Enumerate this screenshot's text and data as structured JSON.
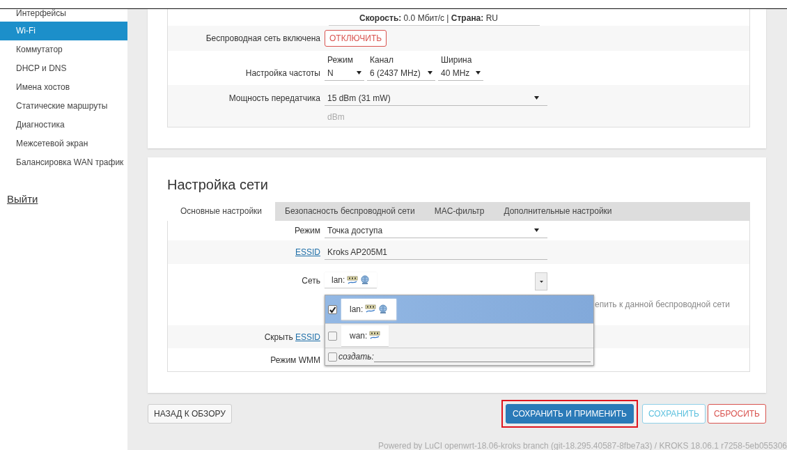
{
  "sidebar": {
    "items": [
      {
        "label": "Интерфейсы",
        "selected": false
      },
      {
        "label": "Wi-Fi",
        "selected": true
      },
      {
        "label": "Коммутатор",
        "selected": false
      },
      {
        "label": "DHCP и DNS",
        "selected": false
      },
      {
        "label": "Имена хостов",
        "selected": false
      },
      {
        "label": "Статические маршруты",
        "selected": false
      },
      {
        "label": "Диагностика",
        "selected": false
      },
      {
        "label": "Межсетевой экран",
        "selected": false
      },
      {
        "label": "Балансировка WAN трафик",
        "selected": false
      }
    ],
    "logout": "Выйти"
  },
  "device": {
    "status_line": "**Скорость:** 0.0 Мбит/с | **Страна:** RU",
    "enable": {
      "label": "Беспроводная сеть включена",
      "button": "ОТКЛЮЧИТЬ"
    },
    "frequency": {
      "label": "Настройка частоты",
      "selects": [
        {
          "caption": "Режим",
          "value": "N"
        },
        {
          "caption": "Канал",
          "value": "6 (2437 MHz)"
        },
        {
          "caption": "Ширина",
          "value": "40 MHz"
        }
      ]
    },
    "power": {
      "label": "Мощность передатчика",
      "value": "15 dBm (31 mW)",
      "hint": "dBm"
    }
  },
  "network": {
    "title": "Настройка сети",
    "tabs": [
      {
        "label": "Основные настройки",
        "selected": true
      },
      {
        "label": "Безопасность беспроводной сети",
        "selected": false
      },
      {
        "label": "MAC-фильтр",
        "selected": false
      },
      {
        "label": "Дополнительные настройки",
        "selected": false
      }
    ],
    "fields": [
      {
        "kind": "select",
        "label": "Режим",
        "value": "Точка доступа"
      },
      {
        "kind": "text",
        "label_link": "ESSID",
        "value": "Kroks AP205M1"
      },
      {
        "kind": "network",
        "label": "Сеть",
        "value": "lan:",
        "wireless": true,
        "hint": "епить к данной беспроводной сети",
        "dropdown": {
          "options": [
            {
              "label": "lan:",
              "wireless": true,
              "checked": true,
              "selected": true
            },
            {
              "label": "wan:",
              "wireless": false,
              "checked": false,
              "selected": false
            }
          ],
          "create": {
            "label": "создать:",
            "checked": false
          }
        }
      },
      {
        "kind": "empty",
        "label": "Скрыть ",
        "label_link": "ESSID"
      },
      {
        "kind": "empty",
        "label": "Режим WMM"
      }
    ]
  },
  "buttons": {
    "back": "НАЗАД К ОБЗОРУ",
    "actions": [
      {
        "label": "СОХРАНИТЬ И ПРИМЕНИТЬ",
        "kind": "primary",
        "highlighted": true
      },
      {
        "label": "СОХРАНИТЬ",
        "kind": "info",
        "highlighted": false
      },
      {
        "label": "СБРОСИТЬ",
        "kind": "danger",
        "highlighted": false
      }
    ]
  },
  "footer": "Powered by LuCI openwrt-18.06-kroks branch (git-18.295.40587-8fbe7a3) / KROKS 18.06.1 r7258-5eb055306"
}
